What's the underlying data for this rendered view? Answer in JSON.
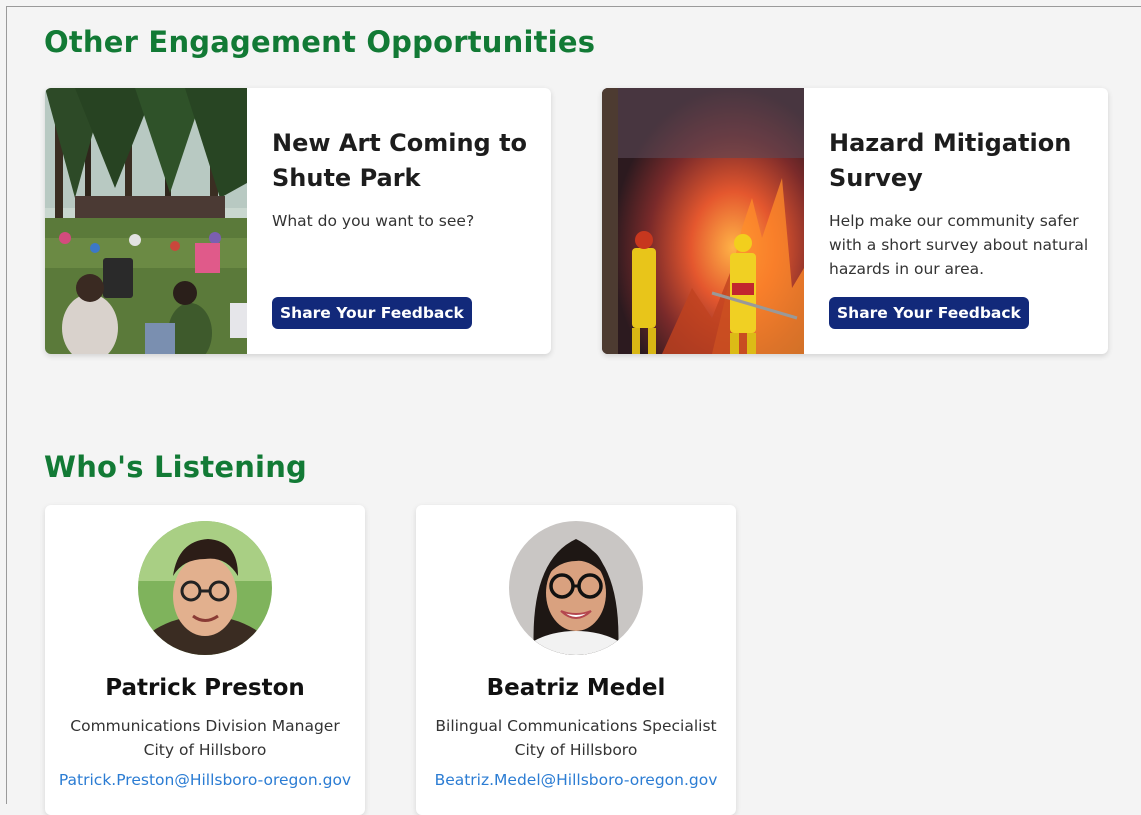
{
  "sections": {
    "engagement_title": "Other Engagement Opportunities",
    "listening_title": "Who's Listening"
  },
  "opportunities": [
    {
      "title": "New Art Coming to Shute Park",
      "description": "What do you want to see?",
      "button_label": "Share Your Feedback",
      "image": "park-crowd-photo"
    },
    {
      "title": "Hazard Mitigation Survey",
      "description": "Help make our community safer with a short survey about natural hazards in our area.",
      "button_label": "Share Your Feedback",
      "image": "firefighters-photo"
    }
  ],
  "people": [
    {
      "name": "Patrick Preston",
      "role": "Communications Division Manager",
      "org": "City of Hillsboro",
      "email": "Patrick.Preston@Hillsboro-oregon.gov",
      "photo": "avatar-patrick"
    },
    {
      "name": "Beatriz Medel",
      "role": "Bilingual Communications Specialist",
      "org": "City of Hillsboro",
      "email": "Beatriz.Medel@Hillsboro-oregon.gov",
      "photo": "avatar-beatriz"
    }
  ],
  "colors": {
    "heading_green": "#127a35",
    "button_navy": "#12297a",
    "link_blue": "#2b7cd3",
    "page_bg": "#f4f4f4"
  }
}
